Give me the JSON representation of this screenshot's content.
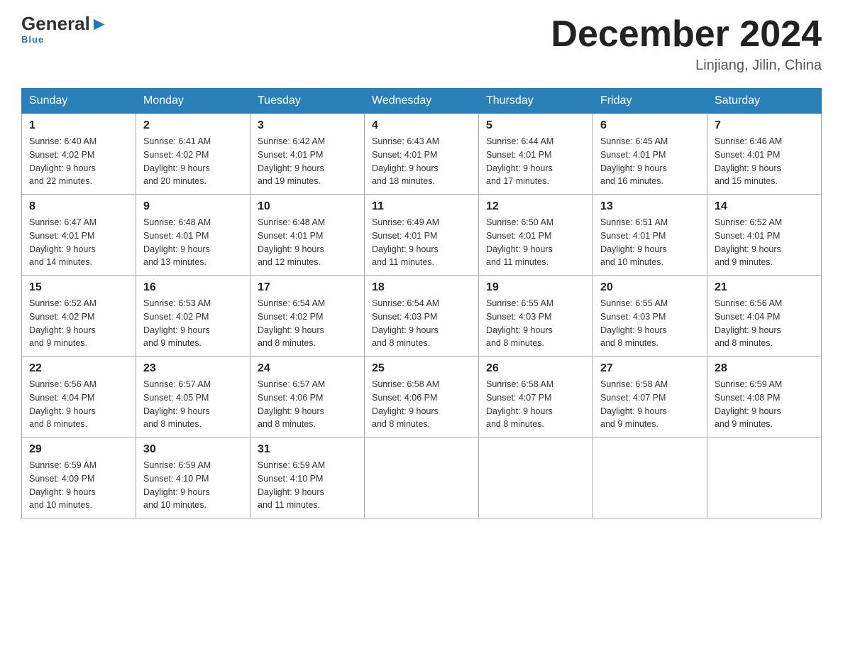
{
  "header": {
    "logo_general": "General",
    "logo_blue": "Blue",
    "logo_sub": "Blue",
    "month_title": "December 2024",
    "location": "Linjiang, Jilin, China"
  },
  "days_of_week": [
    "Sunday",
    "Monday",
    "Tuesday",
    "Wednesday",
    "Thursday",
    "Friday",
    "Saturday"
  ],
  "weeks": [
    [
      {
        "day": "1",
        "sunrise": "6:40 AM",
        "sunset": "4:02 PM",
        "daylight": "9 hours and 22 minutes."
      },
      {
        "day": "2",
        "sunrise": "6:41 AM",
        "sunset": "4:02 PM",
        "daylight": "9 hours and 20 minutes."
      },
      {
        "day": "3",
        "sunrise": "6:42 AM",
        "sunset": "4:01 PM",
        "daylight": "9 hours and 19 minutes."
      },
      {
        "day": "4",
        "sunrise": "6:43 AM",
        "sunset": "4:01 PM",
        "daylight": "9 hours and 18 minutes."
      },
      {
        "day": "5",
        "sunrise": "6:44 AM",
        "sunset": "4:01 PM",
        "daylight": "9 hours and 17 minutes."
      },
      {
        "day": "6",
        "sunrise": "6:45 AM",
        "sunset": "4:01 PM",
        "daylight": "9 hours and 16 minutes."
      },
      {
        "day": "7",
        "sunrise": "6:46 AM",
        "sunset": "4:01 PM",
        "daylight": "9 hours and 15 minutes."
      }
    ],
    [
      {
        "day": "8",
        "sunrise": "6:47 AM",
        "sunset": "4:01 PM",
        "daylight": "9 hours and 14 minutes."
      },
      {
        "day": "9",
        "sunrise": "6:48 AM",
        "sunset": "4:01 PM",
        "daylight": "9 hours and 13 minutes."
      },
      {
        "day": "10",
        "sunrise": "6:48 AM",
        "sunset": "4:01 PM",
        "daylight": "9 hours and 12 minutes."
      },
      {
        "day": "11",
        "sunrise": "6:49 AM",
        "sunset": "4:01 PM",
        "daylight": "9 hours and 11 minutes."
      },
      {
        "day": "12",
        "sunrise": "6:50 AM",
        "sunset": "4:01 PM",
        "daylight": "9 hours and 11 minutes."
      },
      {
        "day": "13",
        "sunrise": "6:51 AM",
        "sunset": "4:01 PM",
        "daylight": "9 hours and 10 minutes."
      },
      {
        "day": "14",
        "sunrise": "6:52 AM",
        "sunset": "4:01 PM",
        "daylight": "9 hours and 9 minutes."
      }
    ],
    [
      {
        "day": "15",
        "sunrise": "6:52 AM",
        "sunset": "4:02 PM",
        "daylight": "9 hours and 9 minutes."
      },
      {
        "day": "16",
        "sunrise": "6:53 AM",
        "sunset": "4:02 PM",
        "daylight": "9 hours and 9 minutes."
      },
      {
        "day": "17",
        "sunrise": "6:54 AM",
        "sunset": "4:02 PM",
        "daylight": "9 hours and 8 minutes."
      },
      {
        "day": "18",
        "sunrise": "6:54 AM",
        "sunset": "4:03 PM",
        "daylight": "9 hours and 8 minutes."
      },
      {
        "day": "19",
        "sunrise": "6:55 AM",
        "sunset": "4:03 PM",
        "daylight": "9 hours and 8 minutes."
      },
      {
        "day": "20",
        "sunrise": "6:55 AM",
        "sunset": "4:03 PM",
        "daylight": "9 hours and 8 minutes."
      },
      {
        "day": "21",
        "sunrise": "6:56 AM",
        "sunset": "4:04 PM",
        "daylight": "9 hours and 8 minutes."
      }
    ],
    [
      {
        "day": "22",
        "sunrise": "6:56 AM",
        "sunset": "4:04 PM",
        "daylight": "9 hours and 8 minutes."
      },
      {
        "day": "23",
        "sunrise": "6:57 AM",
        "sunset": "4:05 PM",
        "daylight": "9 hours and 8 minutes."
      },
      {
        "day": "24",
        "sunrise": "6:57 AM",
        "sunset": "4:06 PM",
        "daylight": "9 hours and 8 minutes."
      },
      {
        "day": "25",
        "sunrise": "6:58 AM",
        "sunset": "4:06 PM",
        "daylight": "9 hours and 8 minutes."
      },
      {
        "day": "26",
        "sunrise": "6:58 AM",
        "sunset": "4:07 PM",
        "daylight": "9 hours and 8 minutes."
      },
      {
        "day": "27",
        "sunrise": "6:58 AM",
        "sunset": "4:07 PM",
        "daylight": "9 hours and 9 minutes."
      },
      {
        "day": "28",
        "sunrise": "6:59 AM",
        "sunset": "4:08 PM",
        "daylight": "9 hours and 9 minutes."
      }
    ],
    [
      {
        "day": "29",
        "sunrise": "6:59 AM",
        "sunset": "4:09 PM",
        "daylight": "9 hours and 10 minutes."
      },
      {
        "day": "30",
        "sunrise": "6:59 AM",
        "sunset": "4:10 PM",
        "daylight": "9 hours and 10 minutes."
      },
      {
        "day": "31",
        "sunrise": "6:59 AM",
        "sunset": "4:10 PM",
        "daylight": "9 hours and 11 minutes."
      },
      null,
      null,
      null,
      null
    ]
  ]
}
